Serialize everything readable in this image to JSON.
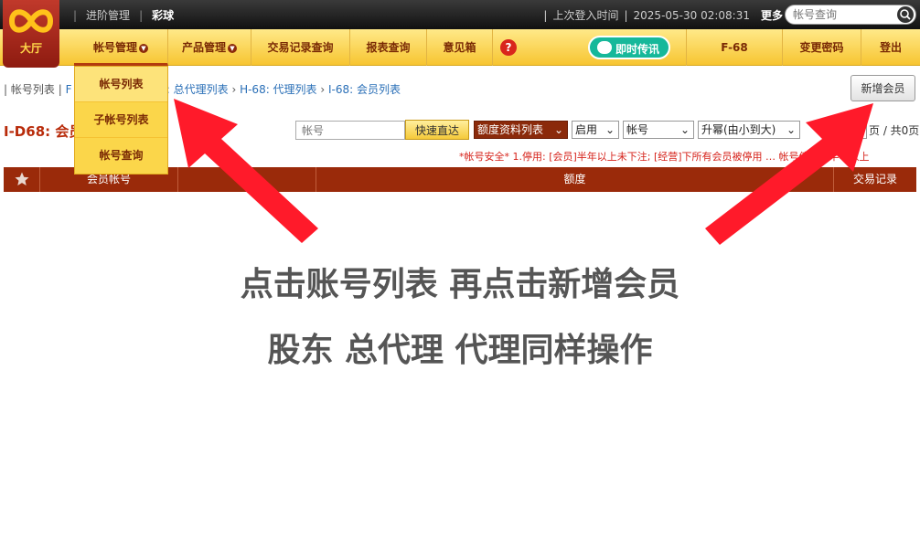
{
  "logo": {
    "text": "大厅"
  },
  "topbar": {
    "items": [
      {
        "label": "进阶管理"
      },
      {
        "label": "彩球"
      }
    ],
    "last_login_label": "上次登入时间",
    "last_login_time": "2025-05-30 02:08:31",
    "more_label": "更多",
    "search_placeholder": "帐号查询"
  },
  "nav": {
    "items": [
      {
        "label": "帐号管理"
      },
      {
        "label": "产品管理"
      },
      {
        "label": "交易记录查询"
      },
      {
        "label": "报表查询"
      },
      {
        "label": "意见箱"
      },
      {
        "label": "?"
      },
      {
        "label": "即时传讯"
      },
      {
        "label": "F-68"
      },
      {
        "label": "变更密码"
      },
      {
        "label": "登出"
      }
    ]
  },
  "dropdown": {
    "items": [
      {
        "label": "帐号列表"
      },
      {
        "label": "子帐号列表"
      },
      {
        "label": "帐号查询"
      }
    ]
  },
  "breadcrumb": {
    "root": "帐号列表",
    "prefix": "F",
    "links": [
      "8: 总代理列表",
      "H-68: 代理列表",
      "I-68: 会员列表"
    ]
  },
  "toolbar": {
    "add_member_label": "新增会员",
    "page_title": "I-D68: 会员",
    "account_placeholder": "帐号",
    "quick_search_label": "快速直达",
    "select_quota": "额度资料列表",
    "select_status": "启用",
    "select_field": "帐号",
    "select_order": "升幂(由小到大)",
    "pager_text": "页 / 共0页"
  },
  "notice": "*帐号安全* 1.停用: [会员]半年以上未下注; [经营]下所有会员被停用 … 帐号停用达半年以上",
  "table": {
    "headers": [
      "会员帐号",
      "会",
      "额度",
      "交易记录"
    ]
  },
  "overlay": {
    "line1": "点击账号列表  再点击新增会员",
    "line2": "股东  总代理  代理同样操作"
  },
  "colors": {
    "accent_red": "#9a2a0a",
    "nav_yellow": "#f7c531",
    "arrow_red": "#ff1a2a"
  }
}
